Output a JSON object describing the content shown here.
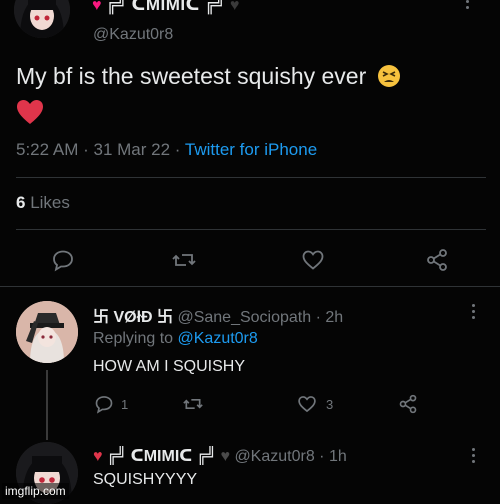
{
  "main_tweet": {
    "display_name_glyph": "╔╝",
    "display_name": "ᑕMIMIᑕ",
    "display_name_tail": "╔╝",
    "handle": "@Kazut0r8",
    "text": "My bf is the sweetest squishy ever",
    "time": "5:22 AM",
    "date": "31 Mar 22",
    "source": "Twitter for iPhone",
    "likes_count": "6",
    "likes_label": "Likes"
  },
  "reply": {
    "display_name": "卐 VØłÐ 卐",
    "handle": "@Sane_Sociopath",
    "time": "2h",
    "replying_to_label": "Replying to",
    "replying_to_handle": "@Kazut0r8",
    "text": "HOW AM I SQUISHY",
    "reply_count": "1",
    "like_count": "3"
  },
  "reply2": {
    "display_name": "ᑕMIMIᑕ",
    "handle": "@Kazut0r8",
    "time": "1h",
    "text": "SQUISHYYYY"
  },
  "watermark": "imgflip.com",
  "separator": "·",
  "colors": {
    "heart": "#f91880",
    "link": "#1d9bf0",
    "muted": "#71767b",
    "divider": "#2f3336"
  }
}
